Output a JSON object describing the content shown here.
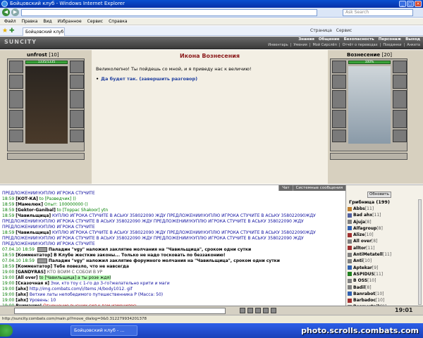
{
  "window": {
    "title": "Бойцовский клуб - Windows Internet Explorer",
    "search_placeholder": "Ask Search"
  },
  "menu": [
    "Файл",
    "Правка",
    "Вид",
    "Избранное",
    "Сервис",
    "Справка"
  ],
  "tab": {
    "label": "Бойцовский клуб"
  },
  "browser_tools": [
    "Страница",
    "Сервис"
  ],
  "game": {
    "logo": "SUNCITY",
    "top_links": [
      "Знания",
      "Общение",
      "Безопасность",
      "Персонаж",
      "Выход"
    ],
    "sub_links": [
      "Инвентарь",
      "Умения",
      "Мой Сирслёп",
      "Отчёт о переводах",
      "Поединки",
      "Анкета"
    ]
  },
  "player": {
    "name": "unfrost",
    "level": "[10]",
    "hp": "1335/1335"
  },
  "npc": {
    "name": "Вознесение",
    "level": "[20]",
    "hp": "100%"
  },
  "dialog": {
    "title": "Икона Вознесения",
    "message": "Великолепно! Ты пойдешь со мной, и я приведу нас к величию!",
    "answer": "Да будет так. (завершить разговор)"
  },
  "chat_tabs": [
    "Чат",
    "Системные сообщения"
  ],
  "chat": [
    {
      "time": "",
      "nick": "",
      "text": "ПРЕДЛОЖЕНИЙ!КУПЛЮ ИГРОКА СТУЧИТЕ",
      "style": "b"
    },
    {
      "time": "18:59",
      "nick": "[КОТ-КА]",
      "text": "to [Разведчик] ))",
      "style": "g"
    },
    {
      "time": "18:59",
      "nick": "[Мамелюк]",
      "text": "Опыт: 100000000 ()",
      "style": "g"
    },
    {
      "time": "18:59",
      "nick": "[Gektor-Ganibal]",
      "text": "to [Торрас Shakoor] ytn",
      "style": "g"
    },
    {
      "time": "18:59",
      "nick": "[Чавильщица]",
      "text": "КУПЛЮ ИГРОКА СТУЧИТЕ В АСЬКУ 358022090 ЖДУ ПРЕДЛОЖЕНИЙ!КУПЛЮ ИГРОКА СТУЧИТЕ В АСЬКУ 358022090ЖДУ",
      "style": "b"
    },
    {
      "time": "",
      "nick": "",
      "text": "ПРЕДЛОЖЕНИЙ!КУПЛЮ ИГРОКА СТУЧИТЕ В АСЬКУ 358022090 ЖДУ ПРЕДЛОЖЕНИЙ!КУПЛЮ ИГРОКА СТУЧИТЕ В АСЬКУ 358022090 ЖДУ",
      "style": "b"
    },
    {
      "time": "",
      "nick": "",
      "text": "ПРЕДЛОЖЕНИЙ!КУПЛЮ ИГРОКА СТУЧИТЕ",
      "style": "b"
    },
    {
      "time": "18:59",
      "nick": "[Чавильщица]",
      "text": "КУПЛЮ ИГРОКА СТУЧИТЕ В АСЬКУ 358022090 ЖДУ ПРЕДЛОЖЕНИЙ!КУПЛЮ ИГРОКА СТУЧИТЕ В АСЬКУ 358022090ЖДУ",
      "style": "b"
    },
    {
      "time": "",
      "nick": "",
      "text": "ПРЕДЛОЖЕНИЙ!КУПЛЮ ИГРОКА СТУЧИТЕ В АСЬКУ 358022090 ЖДУ ПРЕДЛОЖЕНИЙ!КУПЛЮ ИГРОКА СТУЧИТЕ В АСЬКУ 358022090 ЖДУ",
      "style": "b"
    },
    {
      "time": "",
      "nick": "",
      "text": "ПРЕДЛОЖЕНИЙ!КУПЛЮ ИГРОКА СТУЧИТЕ",
      "style": "b"
    },
    {
      "time": "07.04.10 18:59",
      "nick": "",
      "text": "Паладин \"vgy\" наложил заклятие молчания на \"Чавильщица\", сроком одни сутки",
      "style": "n",
      "thumb": true
    },
    {
      "time": "18:59",
      "nick": "[Комментатор]",
      "text": "В Клубе жесткие законы... Только не надо тосковать по беззаконию!",
      "style": "n"
    },
    {
      "time": "",
      "nick": "",
      "text": "",
      "style": "n"
    },
    {
      "time": "07.04.10 18:59",
      "nick": "",
      "text": "Паладин \"vgy\" наложил заклятие форумного молчания на \"Чавильщица\", сроком одни сутки",
      "style": "n",
      "thumb": true
    },
    {
      "time": "18:59",
      "nick": "[Комментатор]",
      "text": "Тебе повезло, что не навсегда",
      "style": "n"
    },
    {
      "time": "19:00",
      "nick": "[GANDYRAS]",
      "text": "КТО ВОЙМ С СОБОЙ В УР",
      "style": "gray"
    },
    {
      "time": "19:00",
      "nick": "[All over]",
      "text": "to [Чавильщица] а ты розе ждя)",
      "style": "hl"
    },
    {
      "time": "19:00",
      "nick": "[Сказочная я]",
      "text": "Эхи, кто тоу с 1-го до 3-го?желательно крити и маги",
      "style": "b"
    },
    {
      "time": "19:00",
      "nick": "[ahx]",
      "text": "http://img.combats.com/i/items /4/body1012. gif",
      "style": "b"
    },
    {
      "time": "19:00",
      "nick": "[ahx]",
      "text": "Ветхие латы непобедимого путешественника Р (Масса: 50)",
      "style": "b"
    },
    {
      "time": "19:00",
      "nick": "[ahx]",
      "text": "Уровень: 10",
      "style": "b"
    },
    {
      "time": "19:00",
      "nick": "Внимание!",
      "text": "Отношение высших сил к вам изменилось.",
      "style": "r"
    }
  ],
  "online": {
    "refresh": "Обновить",
    "location": "Грибница (199)",
    "users": [
      {
        "name": "Abbs",
        "level": "[11]",
        "color": "#c08030"
      },
      {
        "name": "Bad ahx",
        "level": "[11]",
        "color": "#5060a0"
      },
      {
        "name": "Ajuja",
        "level": "[8]",
        "color": "#808080"
      },
      {
        "name": "Alfagroup",
        "level": "[8]",
        "color": "#3060b0"
      },
      {
        "name": "Alize",
        "level": "[10]",
        "color": "#a03030"
      },
      {
        "name": "All over",
        "level": "[8]",
        "color": "#808080"
      },
      {
        "name": "alltor",
        "level": "[11]",
        "color": "#a03030"
      },
      {
        "name": "AntiMetatell",
        "level": "[11]",
        "color": "#808080"
      },
      {
        "name": "Anti",
        "level": "[10]",
        "color": "#808080"
      },
      {
        "name": "Aptekar",
        "level": "[9]",
        "color": "#3060b0"
      },
      {
        "name": "ASPIDUS",
        "level": "[11]",
        "color": "#208020"
      },
      {
        "name": "B OSS",
        "level": "[10]",
        "color": "#808080"
      },
      {
        "name": "Badil",
        "level": "[8]",
        "color": "#808080"
      },
      {
        "name": "Banrabot",
        "level": "[10]",
        "color": "#3060b0"
      },
      {
        "name": "Barbadoc",
        "level": "[10]",
        "color": "#a03030"
      },
      {
        "name": "Besmertnik",
        "level": "[9]",
        "color": "#808080"
      }
    ]
  },
  "clock": "19:01",
  "status_url": "http://suncity.combats.com/main.pl?move_dialog=0&0.312279934201378",
  "taskbar": {
    "task": "Бойцовский клуб - ...",
    "watermark": "photo.scrolls.combats.com"
  }
}
